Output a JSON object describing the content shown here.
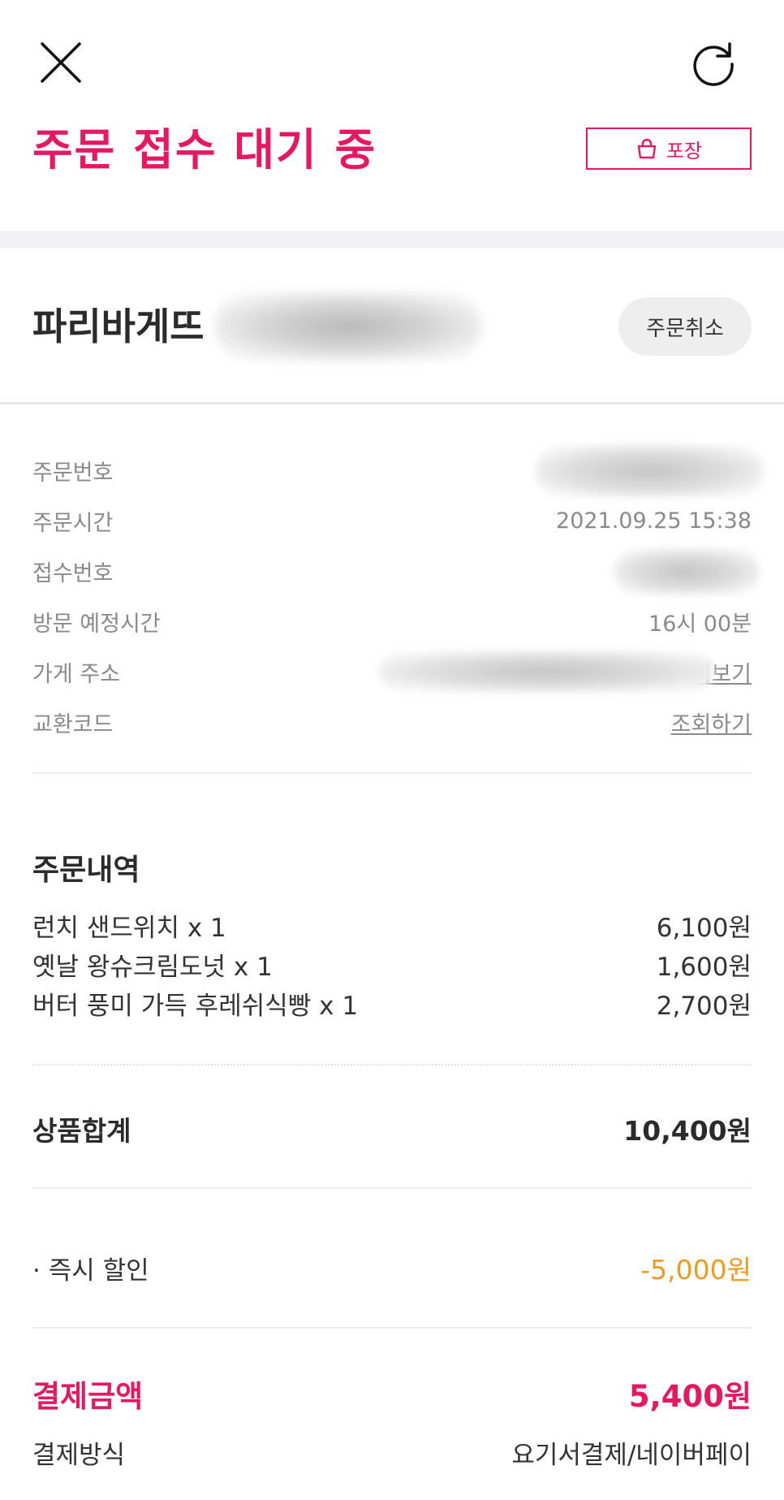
{
  "status": {
    "title": "주문 접수 대기 중",
    "badge_label": "포장"
  },
  "store": {
    "name": "파리바게뜨",
    "cancel_label": "주문취소"
  },
  "info": {
    "order_no_label": "주문번호",
    "order_time_label": "주문시간",
    "order_time_value": "2021.09.25 15:38",
    "receipt_no_label": "접수번호",
    "visit_time_label": "방문 예정시간",
    "visit_time_value": "16시 00분",
    "address_label": "가게 주소",
    "address_link": "치보기",
    "exchange_label": "교환코드",
    "exchange_link": "조회하기"
  },
  "order": {
    "title": "주문내역",
    "items": [
      {
        "name": "런치 샌드위치 x 1",
        "price": "6,100원"
      },
      {
        "name": "옛날 왕슈크림도넛 x 1",
        "price": "1,600원"
      },
      {
        "name": "버터 풍미 가득 후레쉬식빵 x 1",
        "price": "2,700원"
      }
    ]
  },
  "totals": {
    "subtotal_label": "상품합계",
    "subtotal_value": "10,400원",
    "discount_label": "· 즉시 할인",
    "discount_value": "-5,000원",
    "payment_label": "결제금액",
    "payment_value": "5,400원",
    "method_label": "결제방식",
    "method_value": "요기서결제/네이버페이"
  },
  "colors": {
    "accent": "#e5195f",
    "discount": "#f09a1f",
    "muted": "#8a8a8a"
  },
  "icons": {
    "close": "close-icon",
    "refresh": "refresh-icon",
    "bag": "shopping-bag-icon"
  }
}
